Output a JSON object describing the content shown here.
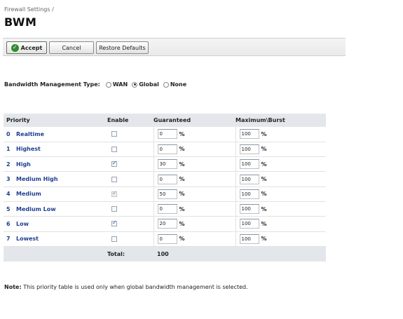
{
  "breadcrumb": "Firewall Settings /",
  "title": "BWM",
  "toolbar": {
    "accept_label": "Accept",
    "cancel_label": "Cancel",
    "restore_label": "Restore Defaults"
  },
  "bwm_type": {
    "label": "Bandwidth Management Type:",
    "options": [
      "WAN",
      "Global",
      "None"
    ],
    "selected": "Global"
  },
  "table": {
    "headers": [
      "Priority",
      "Enable",
      "Guaranteed",
      "Maximum\\Burst"
    ],
    "rows": [
      {
        "num": "0",
        "name": "Realtime",
        "enabled": false,
        "disabled": false,
        "guaranteed": "0",
        "maximum": "100"
      },
      {
        "num": "1",
        "name": "Highest",
        "enabled": false,
        "disabled": false,
        "guaranteed": "0",
        "maximum": "100"
      },
      {
        "num": "2",
        "name": "High",
        "enabled": true,
        "disabled": false,
        "guaranteed": "30",
        "maximum": "100"
      },
      {
        "num": "3",
        "name": "Medium High",
        "enabled": false,
        "disabled": false,
        "guaranteed": "0",
        "maximum": "100"
      },
      {
        "num": "4",
        "name": "Medium",
        "enabled": true,
        "disabled": true,
        "guaranteed": "50",
        "maximum": "100"
      },
      {
        "num": "5",
        "name": "Medium Low",
        "enabled": false,
        "disabled": false,
        "guaranteed": "0",
        "maximum": "100"
      },
      {
        "num": "6",
        "name": "Low",
        "enabled": true,
        "disabled": false,
        "guaranteed": "20",
        "maximum": "100"
      },
      {
        "num": "7",
        "name": "Lowest",
        "enabled": false,
        "disabled": false,
        "guaranteed": "0",
        "maximum": "100"
      }
    ],
    "unit": "%",
    "total_label": "Total:",
    "total_value": "100"
  },
  "note": {
    "label": "Note:",
    "text": "This priority table is used only when global bandwidth management is selected."
  }
}
